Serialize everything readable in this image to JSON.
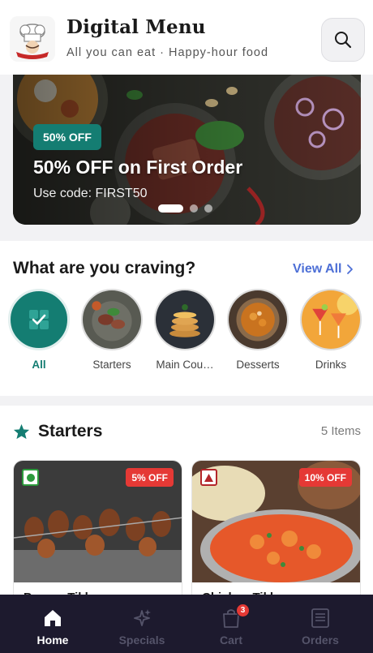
{
  "header": {
    "title": "Digital Menu",
    "subtitle": "All you can eat · Happy-hour food",
    "logo_icon": "chef-logo-icon",
    "search_icon": "search-icon"
  },
  "banner": {
    "badge": "50% OFF",
    "title": "50% OFF on First Order",
    "code_text": "Use code: FIRST50",
    "slides_count": 3,
    "active_slide": 1
  },
  "categories": {
    "heading": "What are you craving?",
    "view_all": "View All",
    "items": [
      {
        "label": "All",
        "active": true,
        "icon": "check-grid-icon"
      },
      {
        "label": "Starters",
        "active": false
      },
      {
        "label": "Main Cou…",
        "active": false
      },
      {
        "label": "Desserts",
        "active": false
      },
      {
        "label": "Drinks",
        "active": false
      }
    ]
  },
  "starters": {
    "title": "Starters",
    "count": "5 Items",
    "icon": "star-icon",
    "cards": [
      {
        "name": "Paneer Tikk…",
        "discount": "5% OFF",
        "veg": true
      },
      {
        "name": "Chicken Tikk…",
        "discount": "10% OFF",
        "veg": false
      }
    ]
  },
  "nav": {
    "items": [
      {
        "label": "Home",
        "icon": "home-icon",
        "active": true
      },
      {
        "label": "Specials",
        "icon": "sparkle-icon",
        "active": false
      },
      {
        "label": "Cart",
        "icon": "cart-icon",
        "active": false,
        "badge": "3"
      },
      {
        "label": "Orders",
        "icon": "receipt-icon",
        "active": false
      }
    ]
  },
  "colors": {
    "accent": "#147d72",
    "link": "#4d6fd6",
    "discount": "#e53935",
    "nav_bg": "#1d1a2e"
  }
}
